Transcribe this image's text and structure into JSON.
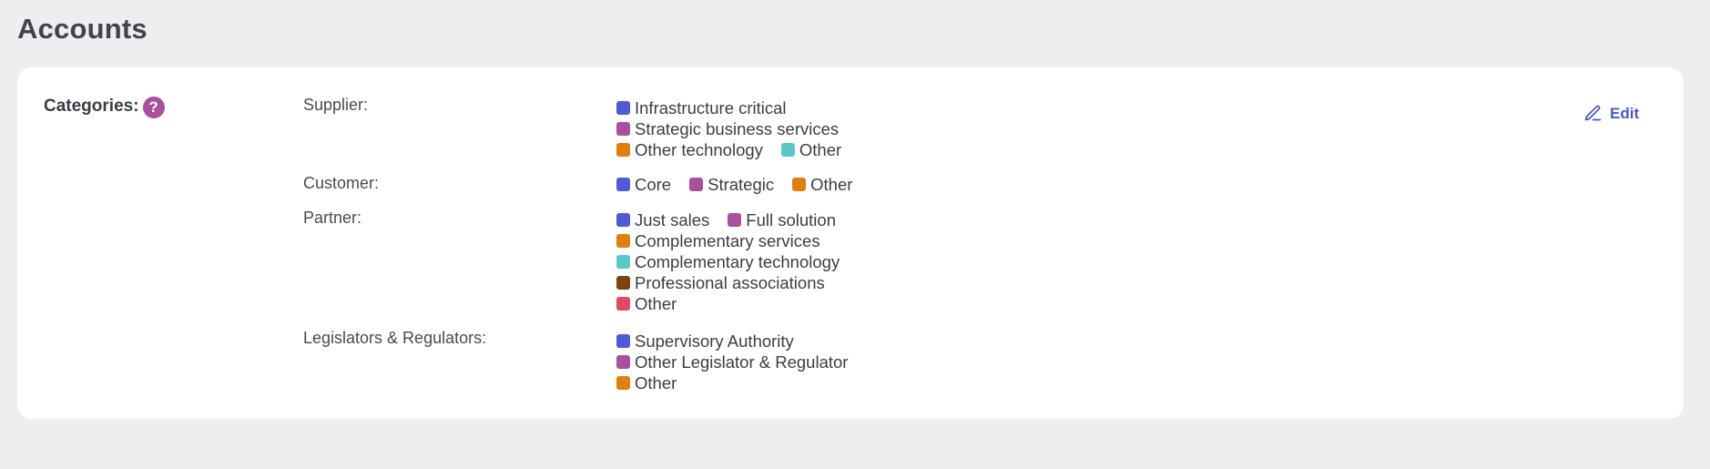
{
  "page": {
    "title": "Accounts"
  },
  "categories": {
    "label": "Categories:",
    "help_glyph": "?",
    "help_icon": "question-circle-icon",
    "edit_label": "Edit",
    "edit_icon": "pencil-icon",
    "colors": {
      "blue": "#4f5bd5",
      "purple": "#a8509d",
      "orange": "#e07f0e",
      "teal": "#5bc8c7",
      "brown": "#7a4310",
      "red": "#e04a68"
    },
    "groups": [
      {
        "label": "Supplier:",
        "rows": [
          [
            {
              "label": "Infrastructure critical",
              "color": "#4f5bd5"
            }
          ],
          [
            {
              "label": "Strategic business services",
              "color": "#a8509d"
            }
          ],
          [
            {
              "label": "Other technology",
              "color": "#e07f0e"
            },
            {
              "label": "Other",
              "color": "#5bc8c7"
            }
          ]
        ]
      },
      {
        "label": "Customer:",
        "rows": [
          [
            {
              "label": "Core",
              "color": "#4f5bd5"
            },
            {
              "label": "Strategic",
              "color": "#a8509d"
            },
            {
              "label": "Other",
              "color": "#e07f0e"
            }
          ]
        ]
      },
      {
        "label": "Partner:",
        "rows": [
          [
            {
              "label": "Just sales",
              "color": "#4f5bd5"
            },
            {
              "label": "Full solution",
              "color": "#a8509d"
            }
          ],
          [
            {
              "label": "Complementary services",
              "color": "#e07f0e"
            }
          ],
          [
            {
              "label": "Complementary technology",
              "color": "#5bc8c7"
            }
          ],
          [
            {
              "label": "Professional associations",
              "color": "#7a4310"
            }
          ],
          [
            {
              "label": "Other",
              "color": "#e04a68"
            }
          ]
        ]
      },
      {
        "label": "Legislators & Regulators:",
        "rows": [
          [
            {
              "label": "Supervisory Authority",
              "color": "#4f5bd5"
            }
          ],
          [
            {
              "label": "Other Legislator & Regulator",
              "color": "#a8509d"
            }
          ],
          [
            {
              "label": "Other",
              "color": "#e07f0e"
            }
          ]
        ]
      }
    ]
  }
}
